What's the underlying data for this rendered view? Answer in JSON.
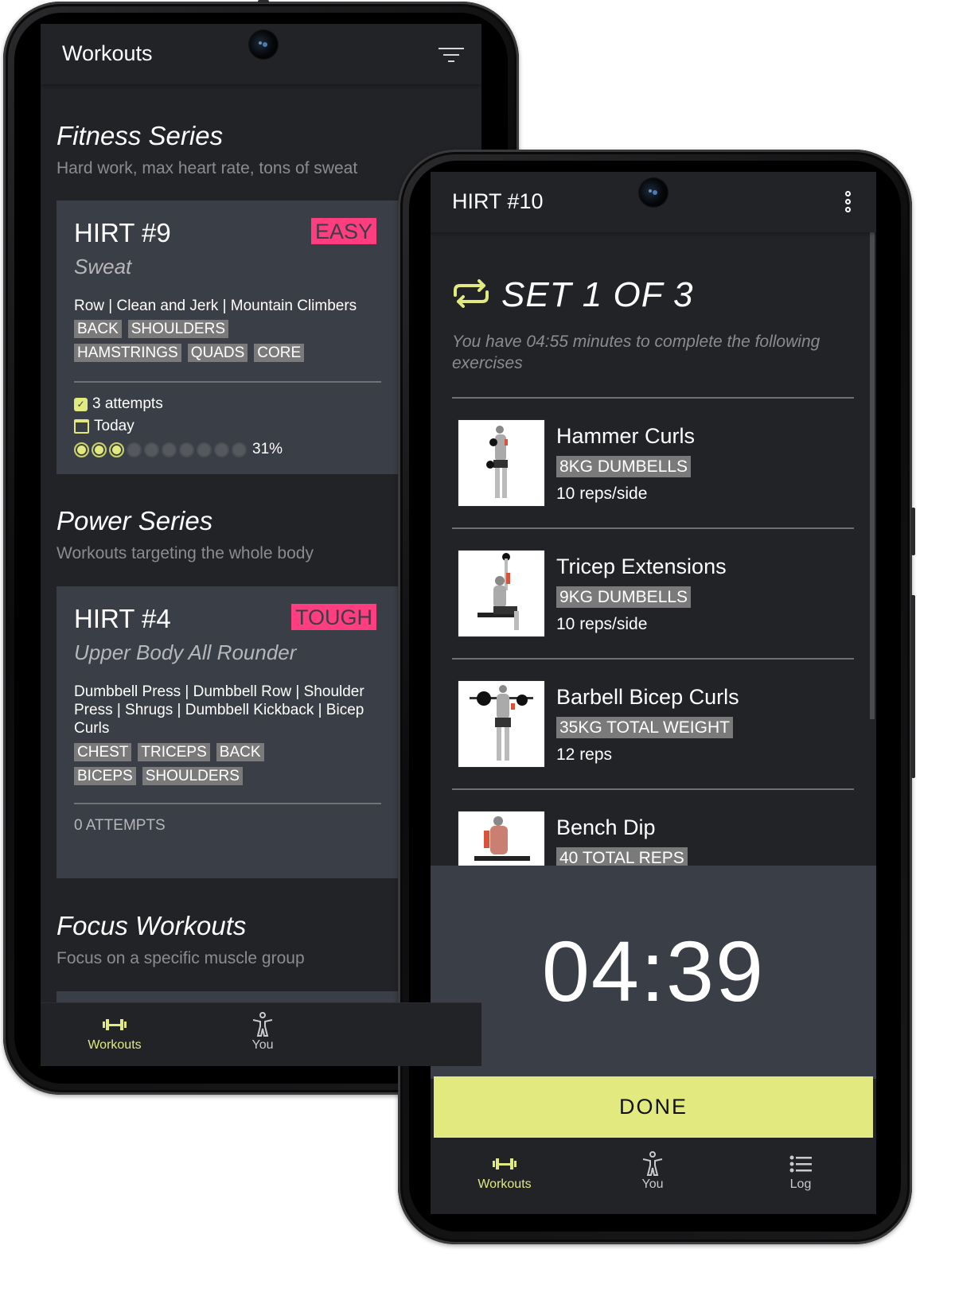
{
  "left_phone": {
    "app_bar": {
      "title": "Workouts",
      "filter_icon": "filter-icon"
    },
    "sections": [
      {
        "title": "Fitness Series",
        "subtitle": "Hard work, max heart rate, tons of sweat",
        "card": {
          "title": "HIRT #9",
          "badge": "EASY",
          "subtitle": "Sweat",
          "exercises": "Row | Clean and Jerk | Mountain Climbers",
          "tags": [
            "BACK",
            "SHOULDERS",
            "HAMSTRINGS",
            "QUADS",
            "CORE"
          ],
          "attempts": "3 attempts",
          "last_done": "Today",
          "progress_dots_total": 10,
          "progress_dots_filled": 3,
          "progress_percent": "31%"
        }
      },
      {
        "title": "Power Series",
        "subtitle": "Workouts targeting the whole body",
        "card": {
          "title": "HIRT #4",
          "badge": "TOUGH",
          "subtitle": "Upper Body All Rounder",
          "exercises": "Dumbbell Press | Dumbbell Row | Shoulder Press | Shrugs | Dumbbell Kickback | Bicep Curls",
          "tags": [
            "CHEST",
            "TRICEPS",
            "BACK",
            "BICEPS",
            "SHOULDERS"
          ],
          "attempts": "0 ATTEMPTS"
        }
      },
      {
        "title": "Focus Workouts",
        "subtitle": "Focus on a specific muscle group"
      }
    ],
    "bottom_nav": [
      {
        "label": "Workouts",
        "icon": "dumbbell-icon",
        "active": true
      },
      {
        "label": "You",
        "icon": "person-icon",
        "active": false
      }
    ]
  },
  "right_phone": {
    "app_bar": {
      "title": "HIRT #10",
      "menu_icon": "more-vert-icon"
    },
    "set": {
      "icon": "repeat-icon",
      "title": "SET 1 OF 3",
      "description": "You have 04:55 minutes to complete the following exercises"
    },
    "exercises": [
      {
        "name": "Hammer Curls",
        "weight": "8KG DUMBELLS",
        "reps": "10 reps/side"
      },
      {
        "name": "Tricep Extensions",
        "weight": "9KG DUMBELLS",
        "reps": "10 reps/side"
      },
      {
        "name": "Barbell Bicep Curls",
        "weight": "35KG TOTAL WEIGHT",
        "reps": "12 reps"
      },
      {
        "name": "Bench Dip",
        "weight": "40 TOTAL REPS",
        "reps": ""
      }
    ],
    "timer": "04:39",
    "done_button": "DONE",
    "bottom_nav": [
      {
        "label": "Workouts",
        "icon": "dumbbell-icon",
        "active": true
      },
      {
        "label": "You",
        "icon": "person-icon",
        "active": false
      },
      {
        "label": "Log",
        "icon": "list-icon",
        "active": false
      }
    ]
  },
  "colors": {
    "accent": "#e2e97f",
    "badge": "#ff3d7f",
    "background": "#222327",
    "card": "#3a3e46",
    "tag": "#7a7a7a"
  }
}
